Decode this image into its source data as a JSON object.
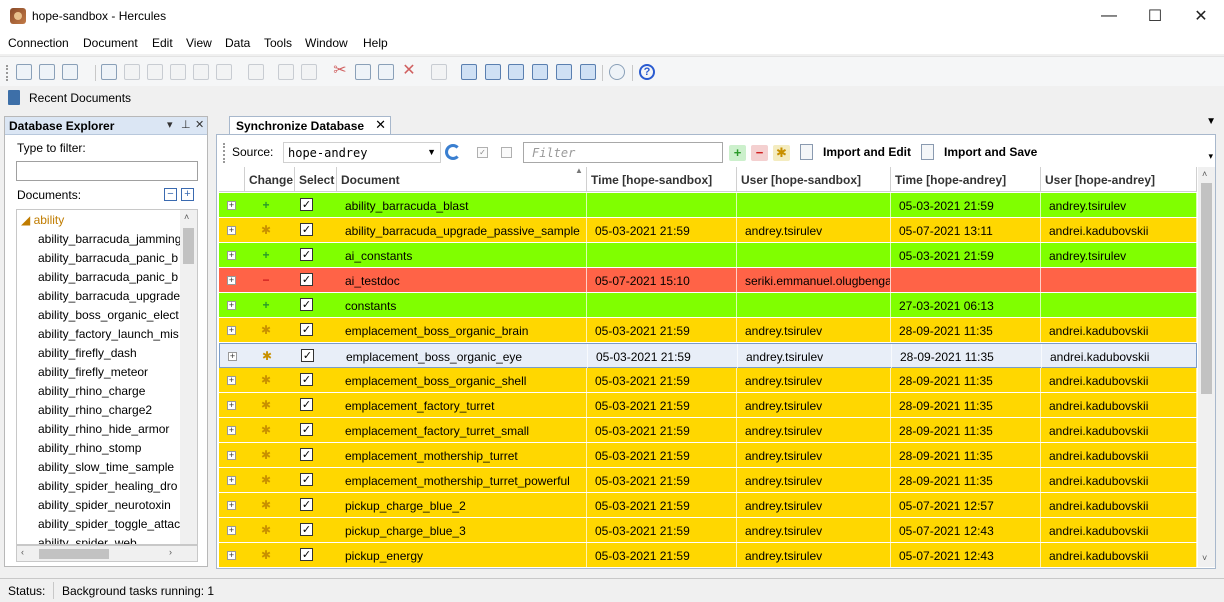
{
  "window": {
    "title": "hope-sandbox - Hercules",
    "app_icon": "hercules-app-icon"
  },
  "window_controls": {
    "minimize": "—",
    "maximize": "☐",
    "close": "✕"
  },
  "menu": [
    "Connection",
    "Document",
    "Edit",
    "View",
    "Data",
    "Tools",
    "Window",
    "Help"
  ],
  "recent_documents": {
    "label": "Recent Documents"
  },
  "explorer": {
    "title": "Database Explorer",
    "filter_label": "Type to filter:",
    "filter_value": "",
    "documents_label": "Documents:",
    "root": "ability",
    "items": [
      "ability_barracuda_jamming",
      "ability_barracuda_panic_b",
      "ability_barracuda_panic_b",
      "ability_barracuda_upgrade",
      "ability_boss_organic_elect",
      "ability_factory_launch_mis",
      "ability_firefly_dash",
      "ability_firefly_meteor",
      "ability_rhino_charge",
      "ability_rhino_charge2",
      "ability_rhino_hide_armor",
      "ability_rhino_stomp",
      "ability_slow_time_sample",
      "ability_spider_healing_dro",
      "ability_spider_neurotoxin",
      "ability_spider_toggle_attac",
      "ability_spider_web"
    ]
  },
  "tab": {
    "title": "Synchronize Database"
  },
  "sync": {
    "source_label": "Source:",
    "source_value": "hope-andrey",
    "filter_placeholder": "Filter",
    "import_edit_label": "Import and Edit",
    "import_save_label": "Import and Save"
  },
  "grid": {
    "columns": [
      "Change",
      "Select",
      "Document",
      "Time [hope-sandbox]",
      "User [hope-sandbox]",
      "Time [hope-andrey]",
      "User [hope-andrey]"
    ],
    "rows": [
      {
        "status": "added",
        "doc": "ability_barracuda_blast",
        "time_sandbox": "",
        "user_sandbox": "",
        "time_andrey": "05-03-2021 21:59",
        "user_andrey": "andrey.tsirulev",
        "selected": false
      },
      {
        "status": "modified",
        "doc": "ability_barracuda_upgrade_passive_sample",
        "time_sandbox": "05-03-2021 21:59",
        "user_sandbox": "andrey.tsirulev",
        "time_andrey": "05-07-2021 13:11",
        "user_andrey": "andrei.kadubovskii",
        "selected": false
      },
      {
        "status": "added",
        "doc": "ai_constants",
        "time_sandbox": "",
        "user_sandbox": "",
        "time_andrey": "05-03-2021 21:59",
        "user_andrey": "andrey.tsirulev",
        "selected": false
      },
      {
        "status": "deleted",
        "doc": "ai_testdoc",
        "time_sandbox": "05-07-2021 15:10",
        "user_sandbox": "seriki.emmanuel.olugbenga",
        "time_andrey": "",
        "user_andrey": "",
        "selected": false
      },
      {
        "status": "added",
        "doc": "constants",
        "time_sandbox": "",
        "user_sandbox": "",
        "time_andrey": "27-03-2021 06:13",
        "user_andrey": "",
        "selected": false
      },
      {
        "status": "modified",
        "doc": "emplacement_boss_organic_brain",
        "time_sandbox": "05-03-2021 21:59",
        "user_sandbox": "andrey.tsirulev",
        "time_andrey": "28-09-2021 11:35",
        "user_andrey": "andrei.kadubovskii",
        "selected": false
      },
      {
        "status": "modified",
        "doc": "emplacement_boss_organic_eye",
        "time_sandbox": "05-03-2021 21:59",
        "user_sandbox": "andrey.tsirulev",
        "time_andrey": "28-09-2021 11:35",
        "user_andrey": "andrei.kadubovskii",
        "selected": true
      },
      {
        "status": "modified",
        "doc": "emplacement_boss_organic_shell",
        "time_sandbox": "05-03-2021 21:59",
        "user_sandbox": "andrey.tsirulev",
        "time_andrey": "28-09-2021 11:35",
        "user_andrey": "andrei.kadubovskii",
        "selected": false
      },
      {
        "status": "modified",
        "doc": "emplacement_factory_turret",
        "time_sandbox": "05-03-2021 21:59",
        "user_sandbox": "andrey.tsirulev",
        "time_andrey": "28-09-2021 11:35",
        "user_andrey": "andrei.kadubovskii",
        "selected": false
      },
      {
        "status": "modified",
        "doc": "emplacement_factory_turret_small",
        "time_sandbox": "05-03-2021 21:59",
        "user_sandbox": "andrey.tsirulev",
        "time_andrey": "28-09-2021 11:35",
        "user_andrey": "andrei.kadubovskii",
        "selected": false
      },
      {
        "status": "modified",
        "doc": "emplacement_mothership_turret",
        "time_sandbox": "05-03-2021 21:59",
        "user_sandbox": "andrey.tsirulev",
        "time_andrey": "28-09-2021 11:35",
        "user_andrey": "andrei.kadubovskii",
        "selected": false
      },
      {
        "status": "modified",
        "doc": "emplacement_mothership_turret_powerful",
        "time_sandbox": "05-03-2021 21:59",
        "user_sandbox": "andrey.tsirulev",
        "time_andrey": "28-09-2021 11:35",
        "user_andrey": "andrei.kadubovskii",
        "selected": false
      },
      {
        "status": "modified",
        "doc": "pickup_charge_blue_2",
        "time_sandbox": "05-03-2021 21:59",
        "user_sandbox": "andrey.tsirulev",
        "time_andrey": "05-07-2021 12:57",
        "user_andrey": "andrei.kadubovskii",
        "selected": false
      },
      {
        "status": "modified",
        "doc": "pickup_charge_blue_3",
        "time_sandbox": "05-03-2021 21:59",
        "user_sandbox": "andrey.tsirulev",
        "time_andrey": "05-07-2021 12:43",
        "user_andrey": "andrei.kadubovskii",
        "selected": false
      },
      {
        "status": "modified",
        "doc": "pickup_energy",
        "time_sandbox": "05-03-2021 21:59",
        "user_sandbox": "andrey.tsirulev",
        "time_andrey": "05-07-2021 12:43",
        "user_andrey": "andrei.kadubovskii",
        "selected": false
      }
    ]
  },
  "status": {
    "label": "Status:",
    "text": "Background tasks running: 1"
  },
  "colors": {
    "added": "#80ff00",
    "modified": "#ffd700",
    "deleted": "#ff6347",
    "selected_row": "#e8eef8"
  }
}
